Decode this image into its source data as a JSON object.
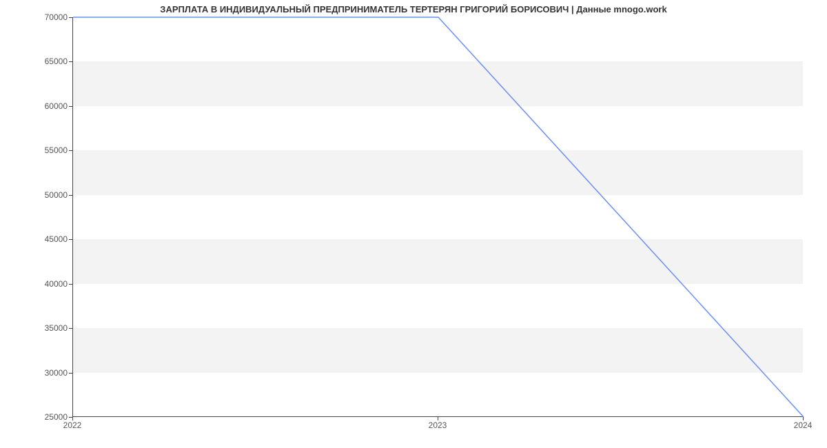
{
  "chart_data": {
    "type": "line",
    "title": "ЗАРПЛАТА В ИНДИВИДУАЛЬНЫЙ ПРЕДПРИНИМАТЕЛЬ ТЕРТЕРЯН ГРИГОРИЙ БОРИСОВИЧ | Данные mnogo.work",
    "xlabel": "",
    "ylabel": "",
    "x": [
      2022,
      2023,
      2024
    ],
    "values": [
      70000,
      70000,
      25000
    ],
    "x_ticks": [
      2022,
      2023,
      2024
    ],
    "y_ticks": [
      25000,
      30000,
      35000,
      40000,
      45000,
      50000,
      55000,
      60000,
      65000,
      70000
    ],
    "xlim": [
      2022,
      2024
    ],
    "ylim": [
      25000,
      70000
    ],
    "line_color": "#6b8ff2",
    "band_color": "#f3f3f3"
  }
}
